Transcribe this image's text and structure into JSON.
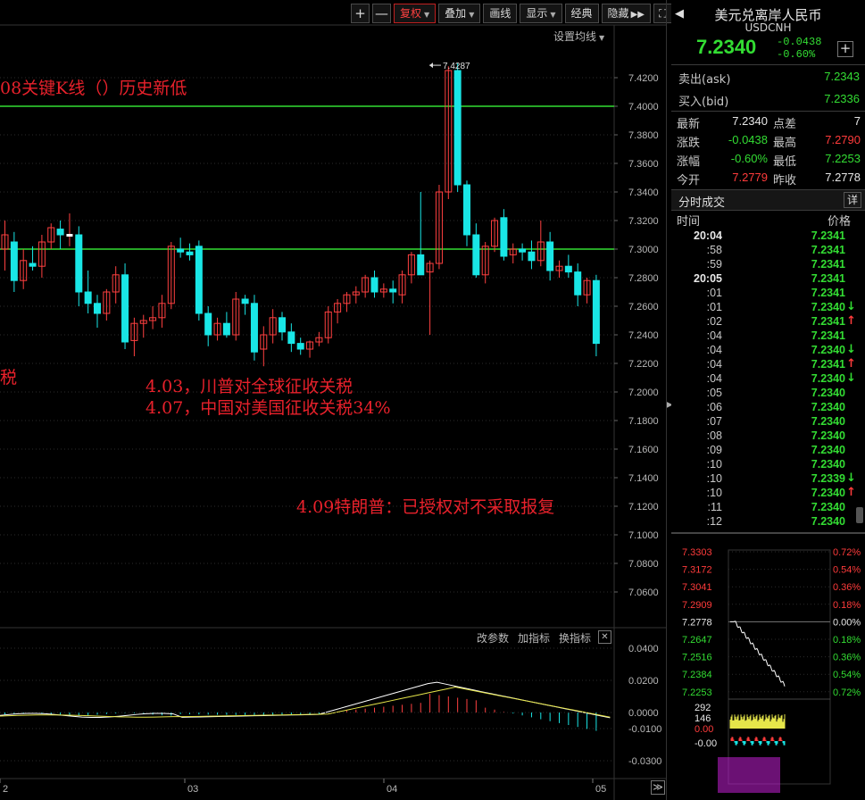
{
  "toolbar": {
    "plus": "+",
    "minus": "—",
    "fuquan": "复权",
    "diejia": "叠加",
    "huaxian": "画线",
    "xianshi": "显示",
    "jingdian": "经典",
    "yincang": "隐藏",
    "expand": "⛶"
  },
  "setting_ma": "设置均线",
  "annotations": {
    "a1": "08关键K线（）历史新低",
    "a2": "4.03，川普对全球征收关税",
    "a3": "4.07，中国对美国征收关税34%",
    "a4": "4.09特朗普：已授权对不采取报复",
    "a5": "税"
  },
  "main_chart": {
    "price_axis": [
      "7.4200",
      "7.4000",
      "7.3800",
      "7.3600",
      "7.3400",
      "7.3200",
      "7.3000",
      "7.2800",
      "7.2600",
      "7.2400",
      "7.2200",
      "7.2000",
      "7.1800",
      "7.1600",
      "7.1400",
      "7.1200",
      "7.1000",
      "7.0800",
      "7.0600"
    ],
    "high_label": "7.4287",
    "horizontal_lines": [
      7.4,
      7.3
    ],
    "line_color": "#33dd33",
    "up_color": "#ff4040",
    "down_color": "#19e6e6"
  },
  "indicator": {
    "change_params": "改参数",
    "add_indicator": "加指标",
    "switch_indicator": "换指标",
    "close": "✕",
    "axis": [
      "0.0400",
      "0.0200",
      "0.0000",
      "-0.0100",
      "-0.0300"
    ]
  },
  "date_axis": [
    "2",
    "03",
    "04",
    "05"
  ],
  "nav_button": "≫",
  "quote": {
    "title": "美元兑离岸人民币",
    "code": "USDCNH",
    "price": "7.2340",
    "change": "-0.0438",
    "change_pct": "-0.60%",
    "ask_label": "卖出(ask)",
    "ask": "7.2343",
    "bid_label": "买入(bid)",
    "bid": "7.2336",
    "stats": {
      "latest_label": "最新",
      "latest": "7.2340",
      "spread_label": "点差",
      "spread": "7",
      "chg_label": "涨跌",
      "chg": "-0.0438",
      "high_label": "最高",
      "high": "7.2790",
      "pct_label": "涨幅",
      "pct": "-0.60%",
      "low_label": "最低",
      "low": "7.2253",
      "open_label": "今开",
      "open": "7.2779",
      "prev_label": "昨收",
      "prev": "7.2778"
    }
  },
  "ticks": {
    "title": "分时成交",
    "detail": "详",
    "col_time": "时间",
    "col_price": "价格",
    "rows": [
      {
        "t": "20:04",
        "p": "7.2341",
        "a": ""
      },
      {
        "t": ":58",
        "p": "7.2341",
        "a": ""
      },
      {
        "t": ":59",
        "p": "7.2341",
        "a": ""
      },
      {
        "t": "20:05",
        "p": "7.2341",
        "a": ""
      },
      {
        "t": ":01",
        "p": "7.2341",
        "a": ""
      },
      {
        "t": ":01",
        "p": "7.2340",
        "a": "down"
      },
      {
        "t": ":02",
        "p": "7.2341",
        "a": "up"
      },
      {
        "t": ":04",
        "p": "7.2341",
        "a": ""
      },
      {
        "t": ":04",
        "p": "7.2340",
        "a": "down"
      },
      {
        "t": ":04",
        "p": "7.2341",
        "a": "up"
      },
      {
        "t": ":04",
        "p": "7.2340",
        "a": "down"
      },
      {
        "t": ":05",
        "p": "7.2340",
        "a": ""
      },
      {
        "t": ":06",
        "p": "7.2340",
        "a": ""
      },
      {
        "t": ":07",
        "p": "7.2340",
        "a": ""
      },
      {
        "t": ":08",
        "p": "7.2340",
        "a": ""
      },
      {
        "t": ":09",
        "p": "7.2340",
        "a": ""
      },
      {
        "t": ":10",
        "p": "7.2340",
        "a": ""
      },
      {
        "t": ":10",
        "p": "7.2339",
        "a": "down"
      },
      {
        "t": ":10",
        "p": "7.2340",
        "a": "up"
      },
      {
        "t": ":11",
        "p": "7.2340",
        "a": ""
      },
      {
        "t": ":12",
        "p": "7.2340",
        "a": ""
      }
    ]
  },
  "intraday": {
    "left_axis": [
      "7.3303",
      "7.3172",
      "7.3041",
      "7.2909",
      "7.2778",
      "7.2647",
      "7.2516",
      "7.2384",
      "7.2253"
    ],
    "right_axis": [
      "0.72%",
      "0.54%",
      "0.36%",
      "0.18%",
      "0.00%",
      "0.18%",
      "0.36%",
      "0.54%",
      "0.72%"
    ],
    "vol_axis": [
      "292",
      "146",
      "0.00"
    ],
    "macd_axis": [
      "-0.00"
    ]
  }
}
